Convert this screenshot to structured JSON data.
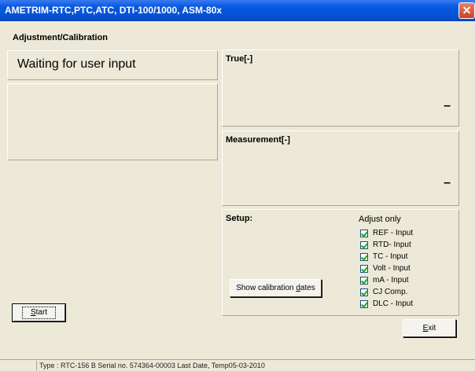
{
  "window": {
    "title": "AMETRIM-RTC,PTC,ATC, DTI-100/1000, ASM-80x",
    "close_glyph": "✕"
  },
  "section_title": "Adjustment/Calibration",
  "status_message": "Waiting for user input",
  "true_panel": {
    "label": "True[-]",
    "value": "–"
  },
  "measurement_panel": {
    "label": "Measurement[-]",
    "value": "–"
  },
  "setup": {
    "label": "Setup:",
    "adjust_only_title": "Adjust only",
    "options": [
      {
        "label": "REF - Input",
        "checked": true
      },
      {
        "label": "RTD- Input",
        "checked": true
      },
      {
        "label": "TC - Input",
        "checked": true
      },
      {
        "label": "Volt - Input",
        "checked": true
      },
      {
        "label": "mA - Input",
        "checked": true
      },
      {
        "label": "CJ Comp.",
        "checked": true
      },
      {
        "label": "DLC - Input",
        "checked": true
      }
    ],
    "show_dates_button": {
      "pre": "Show calibration ",
      "hot": "d",
      "post": "ates"
    }
  },
  "start_button": {
    "hot": "S",
    "post": "tart"
  },
  "exit_button": {
    "hot": "E",
    "post": "xit"
  },
  "statusbar": {
    "text": "Type : RTC-156 B Serial no. 574364-00003 Last Date, Temp05-03-2010"
  }
}
